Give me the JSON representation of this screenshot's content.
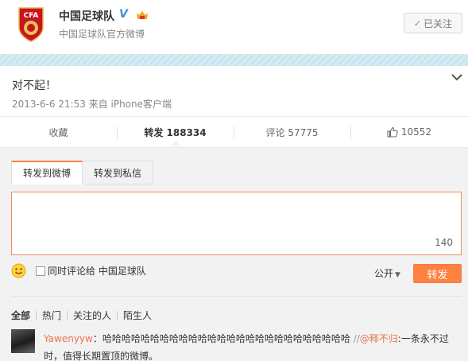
{
  "account": {
    "name": "中国足球队",
    "subtitle": "中国足球队官方微博",
    "logo_text": "CFA",
    "verified_mark": "V",
    "follow_label": "已关注",
    "follow_check": "✓"
  },
  "post": {
    "text": "对不起！",
    "meta": "2013-6-6 21:53 来自 iPhone客户端"
  },
  "actions": {
    "favorite": "收藏",
    "repost": "转发 188334",
    "comment": "评论 57775",
    "like": "10552"
  },
  "repost_panel": {
    "tabs": [
      "转发到微博",
      "转发到私信"
    ],
    "counter": "140",
    "also_comment": "同时评论给 中国足球队",
    "visibility": "公开",
    "submit": "转发"
  },
  "filters": [
    "全部",
    "热门",
    "关注的人",
    "陌生人"
  ],
  "comment": {
    "user": "Yawenyyw",
    "text": "：哈哈哈哈哈哈哈哈哈哈哈哈哈哈哈哈哈哈哈哈哈哈哈哈哈哈",
    "slashes": " //",
    "mention": "@释不归",
    "rest": ":一条永不过时，值得长期置顶的微博。"
  },
  "colors": {
    "accent": "#ff8140",
    "link": "#eb7350",
    "verified": "#3a8fd8"
  }
}
